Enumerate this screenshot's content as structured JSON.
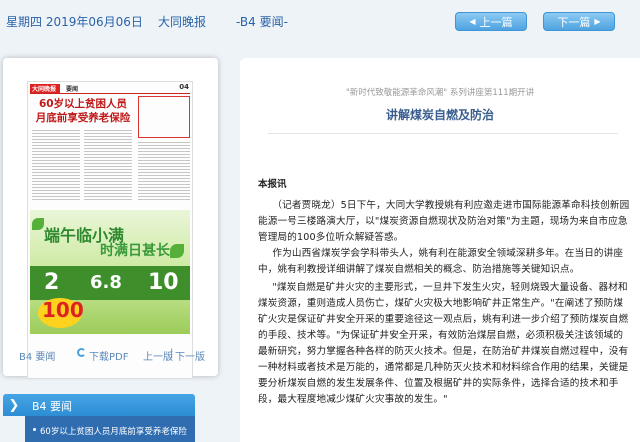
{
  "header": {
    "date": "星期四 2019年06月06日",
    "paper": "大同晚报",
    "page": "-B4 要闻-",
    "prev_label": "上一篇",
    "next_label": "下一篇"
  },
  "thumbnail": {
    "masthead": "大同晚报",
    "section": "要闻",
    "page_no": "04",
    "headline_line1": "60岁以上贫困人员",
    "headline_line2": "月底前享受养老保险",
    "ad_title1": "端午临小满",
    "ad_title2": "时满日甚长",
    "ad_num1": "2",
    "ad_num2": "6.8",
    "ad_num3": "10",
    "ad_badge": "100"
  },
  "panel_links": {
    "page": "B4 要闻",
    "pdf": "下载PDF",
    "prev_page": "上一版",
    "next_page": "下一版"
  },
  "section_nav": {
    "title": "B4  要闻",
    "items": [
      "60岁以上贫困人员月底前享受养老保险"
    ]
  },
  "article": {
    "kicker": "\"新时代致敬能源革命风潮\" 系列讲座第111期开讲",
    "title": "讲解煤炭自燃及防治",
    "byline": "本报讯",
    "paragraphs": [
      "（记者贾晓龙）5日下午，大同大学教授姚有利应邀走进市国际能源革命科技创新园能源一号三楼路演大厅，以\"煤炭资源自燃现状及防治对策\"为主题，现场为来自市应急管理局的100多位听众解疑答惑。",
      "作为山西省煤炭学会学科带头人，姚有利在能源安全领域深耕多年。在当日的讲座中，姚有利教授详细讲解了煤炭自燃相关的概念、防治措施等关键知识点。",
      "\"煤炭自燃是矿井火灾的主要形式，一旦井下发生火灾，轻则烧毁大量设备、器材和煤炭资源，重则造成人员伤亡，煤矿火灾极大地影响矿井正常生产。\"在阐述了预防煤矿火灾是保证矿井安全开采的重要途径这一观点后，姚有利进一步介绍了预防煤炭自燃的手段、技术等。\"为保证矿井安全开采，有效防治煤层自燃，必须积极关注该领域的最新研究，努力掌握各种各样的防灭火技术。但是，在防治矿井煤炭自燃过程中，没有一种材料或者技术是万能的，通常都是几种防灭火技术和材料综合作用的结果，关键是要分析煤炭自燃的发生发展条件、位置及根据矿井的实际条件，选择合适的技术和手段，最大程度地减少煤矿火灾事故的发生。\""
    ]
  },
  "colors": {
    "link_blue": "#2a63a8",
    "button_blue": "#4ea3e0",
    "nav_dark": "#2f6db0"
  }
}
